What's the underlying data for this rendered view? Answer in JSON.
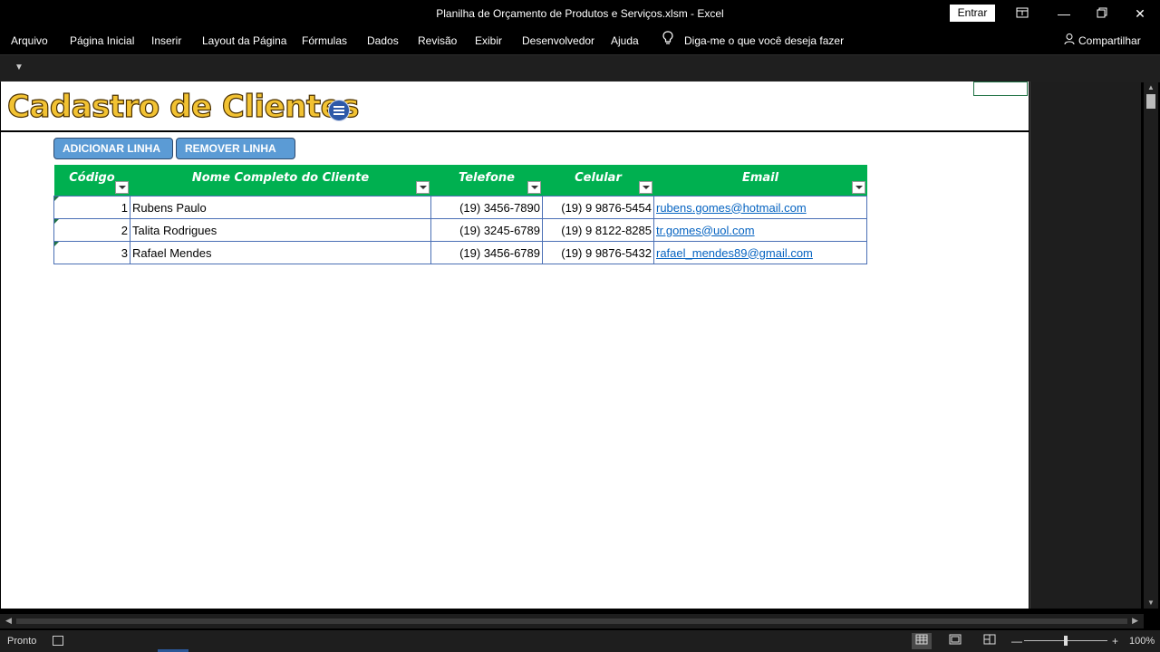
{
  "window": {
    "title": "Planilha de Orçamento de Produtos e Serviços.xlsm  -  Excel",
    "signin_label": "Entrar"
  },
  "menu": {
    "items": [
      "Arquivo",
      "Página Inicial",
      "Inserir",
      "Layout da Página",
      "Fórmulas",
      "Dados",
      "Revisão",
      "Exibir",
      "Desenvolvedor",
      "Ajuda"
    ],
    "tell_me": "Diga-me o que você deseja fazer",
    "share_label": "Compartilhar"
  },
  "sheet": {
    "title": "Cadastro de Clientes",
    "buttons": {
      "add": "ADICIONAR LINHA",
      "remove": "REMOVER LINHA"
    },
    "table": {
      "headers": [
        "Código",
        "Nome Completo do Cliente",
        "Telefone",
        "Celular",
        "Email"
      ],
      "rows": [
        [
          "1",
          "Rubens Paulo",
          "(19) 3456-7890",
          "(19) 9 9876-5454",
          "rubens.gomes@hotmail.com"
        ],
        [
          "2",
          "Talita Rodrigues",
          "(19) 3245-6789",
          "(19) 9 8122-8285",
          "tr.gomes@uol.com"
        ],
        [
          "3",
          "Rafael Mendes",
          "(19) 3456-6789",
          "(19) 9 9876-5432",
          "rafael_mendes89@gmail.com"
        ]
      ]
    }
  },
  "status": {
    "ready": "Pronto",
    "zoom": "100%",
    "zoom_fraction": 0.5
  },
  "colors": {
    "header_green": "#00b050",
    "button_blue": "#5b9bd5",
    "title_gold": "#f2c232",
    "link_blue": "#0563c1"
  }
}
